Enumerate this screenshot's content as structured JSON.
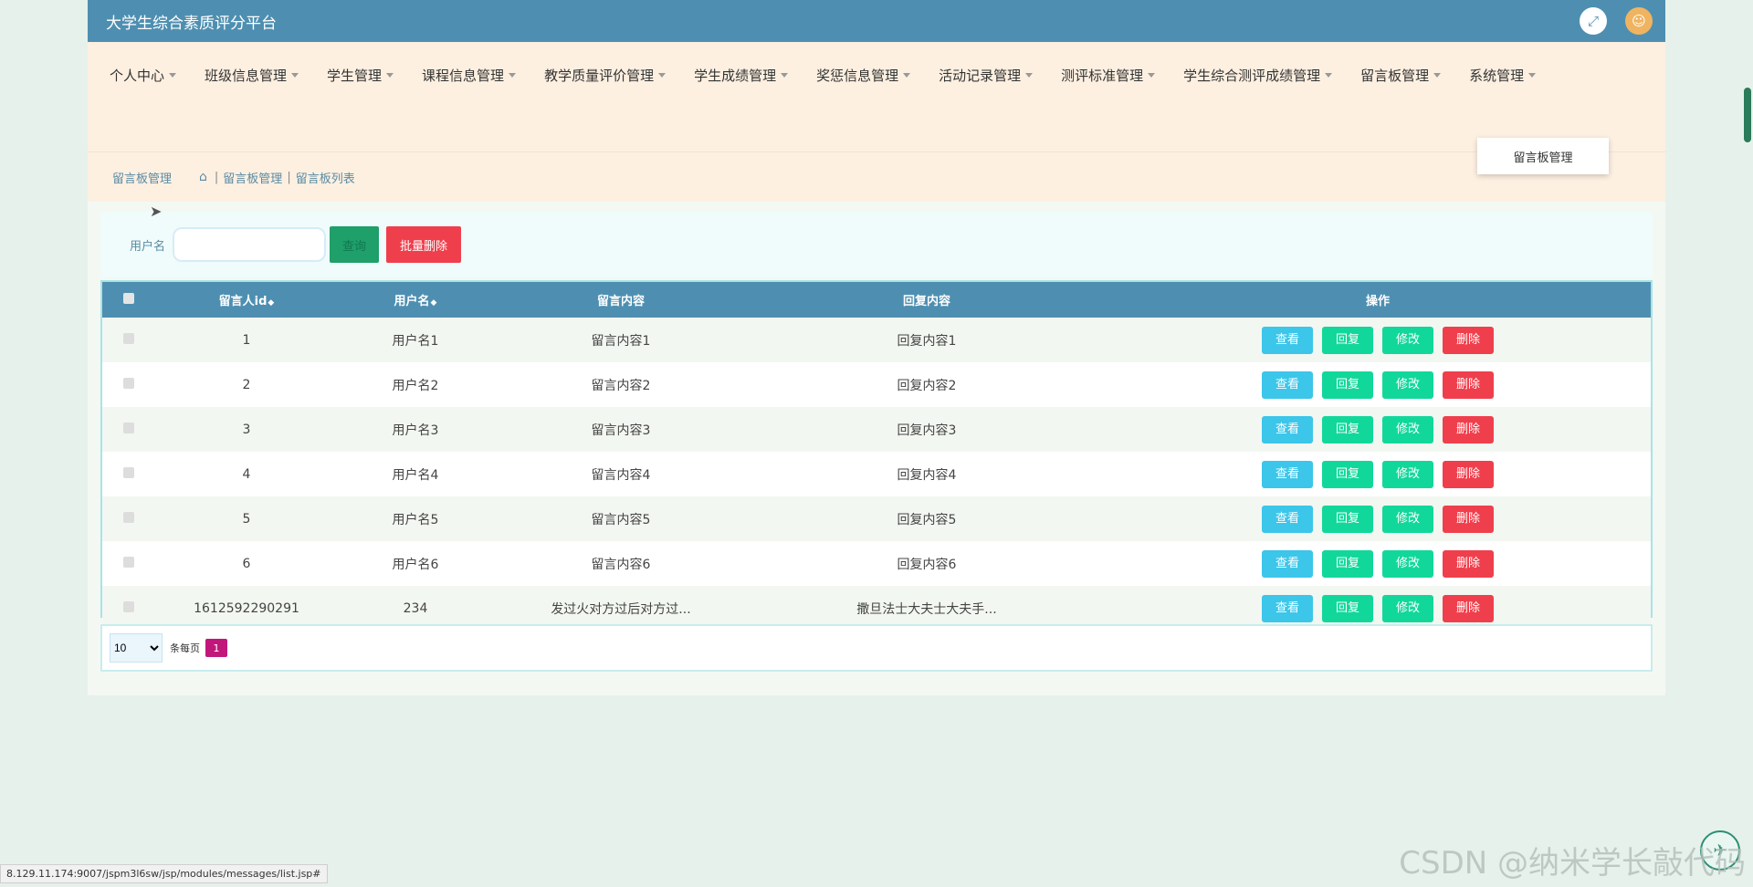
{
  "header": {
    "title": "大学生综合素质评分平台"
  },
  "menu": [
    "个人中心",
    "班级信息管理",
    "学生管理",
    "课程信息管理",
    "教学质量评价管理",
    "学生成绩管理",
    "奖惩信息管理",
    "活动记录管理",
    "测评标准管理",
    "学生综合测评成绩管理",
    "留言板管理",
    "系统管理"
  ],
  "dropdown": {
    "item": "留言板管理"
  },
  "breadcrumb": {
    "section": "留言板管理",
    "path1": "留言板管理",
    "path2": "留言板列表",
    "sep": "|"
  },
  "search": {
    "label": "用户名",
    "placeholder": "",
    "search_btn": "查询",
    "batch_delete": "批量删除"
  },
  "table": {
    "headers": {
      "id": "留言人id",
      "username": "用户名",
      "content": "留言内容",
      "reply": "回复内容",
      "actions": "操作"
    },
    "rows": [
      {
        "id": "1",
        "username": "用户名1",
        "content": "留言内容1",
        "reply": "回复内容1"
      },
      {
        "id": "2",
        "username": "用户名2",
        "content": "留言内容2",
        "reply": "回复内容2"
      },
      {
        "id": "3",
        "username": "用户名3",
        "content": "留言内容3",
        "reply": "回复内容3"
      },
      {
        "id": "4",
        "username": "用户名4",
        "content": "留言内容4",
        "reply": "回复内容4"
      },
      {
        "id": "5",
        "username": "用户名5",
        "content": "留言内容5",
        "reply": "回复内容5"
      },
      {
        "id": "6",
        "username": "用户名6",
        "content": "留言内容6",
        "reply": "回复内容6"
      },
      {
        "id": "1612592290291",
        "username": "234",
        "content": "发过火对方过后对方过...",
        "reply": "撒旦法士大夫士大夫手..."
      }
    ],
    "actions": {
      "view": "查看",
      "reply": "回复",
      "edit": "修改",
      "delete": "删除"
    }
  },
  "pager": {
    "page_size": "10",
    "per_label": "条每页",
    "current_page": "1"
  },
  "status_url": "8.129.11.174:9007/jspm3l6sw/jsp/modules/messages/list.jsp#",
  "watermark": "CSDN @纳米学长敲代码",
  "colors": {
    "header": "#4e8fb1",
    "menubar": "#fdf0e1",
    "view": "#3bc6ea",
    "reply": "#11d89a",
    "delete": "#f03f4c"
  }
}
